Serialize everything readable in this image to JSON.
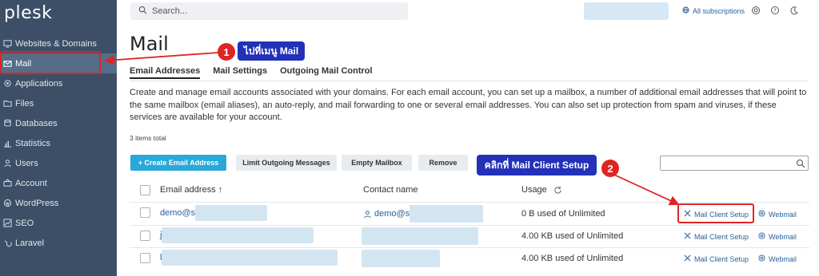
{
  "sidebar": {
    "logo": "plesk",
    "items": [
      {
        "label": "Websites & Domains",
        "icon": "monitor-icon"
      },
      {
        "label": "Mail",
        "icon": "mail-icon"
      },
      {
        "label": "Applications",
        "icon": "gear-icon"
      },
      {
        "label": "Files",
        "icon": "folder-icon"
      },
      {
        "label": "Databases",
        "icon": "database-icon"
      },
      {
        "label": "Statistics",
        "icon": "bar-chart-icon"
      },
      {
        "label": "Users",
        "icon": "user-icon"
      },
      {
        "label": "Account",
        "icon": "account-icon"
      },
      {
        "label": "WordPress",
        "icon": "wordpress-icon"
      },
      {
        "label": "SEO",
        "icon": "seo-icon"
      },
      {
        "label": "Laravel",
        "icon": "laravel-icon"
      }
    ],
    "active_index": 1
  },
  "topbar": {
    "search_placeholder": "Search...",
    "subscriptions": "All subscriptions"
  },
  "page": {
    "title": "Mail",
    "tabs": [
      "Email Addresses",
      "Mail Settings",
      "Outgoing Mail Control"
    ],
    "active_tab": 0,
    "description": "Create and manage email accounts associated with your domains. For each email account, you can set up a mailbox, a number of additional email addresses that will point to the same mailbox (email aliases), an auto-reply, and mail forwarding to one or several email addresses. You can also set up protection from spam and viruses, if these services are available for your account.",
    "count": "3 items total"
  },
  "toolbar": {
    "create": "+ Create Email Address",
    "limit": "Limit Outgoing Messages",
    "empty": "Empty Mailbox",
    "remove": "Remove"
  },
  "table": {
    "headers": {
      "email": "Email address ↑",
      "contact": "Contact name",
      "usage": "Usage"
    },
    "rows": [
      {
        "email": "demo@s",
        "contact": "demo@s",
        "usage": "0 B used of Unlimited",
        "setup": "Mail Client Setup",
        "webmail": "Webmail"
      },
      {
        "email": "j",
        "contact": "",
        "usage": "4.00 KB used of Unlimited",
        "setup": "Mail Client Setup",
        "webmail": "Webmail"
      },
      {
        "email": "l",
        "contact": "",
        "usage": "4.00 KB used of Unlimited",
        "setup": "Mail Client Setup",
        "webmail": "Webmail"
      }
    ]
  },
  "annotations": {
    "step1_number": "1",
    "step1_text": "ไปที่เมนู Mail",
    "step2_number": "2",
    "step2_text": "คลิกที่ Mail Client Setup",
    "color": "#e02424",
    "callout_color": "#2231b8"
  }
}
